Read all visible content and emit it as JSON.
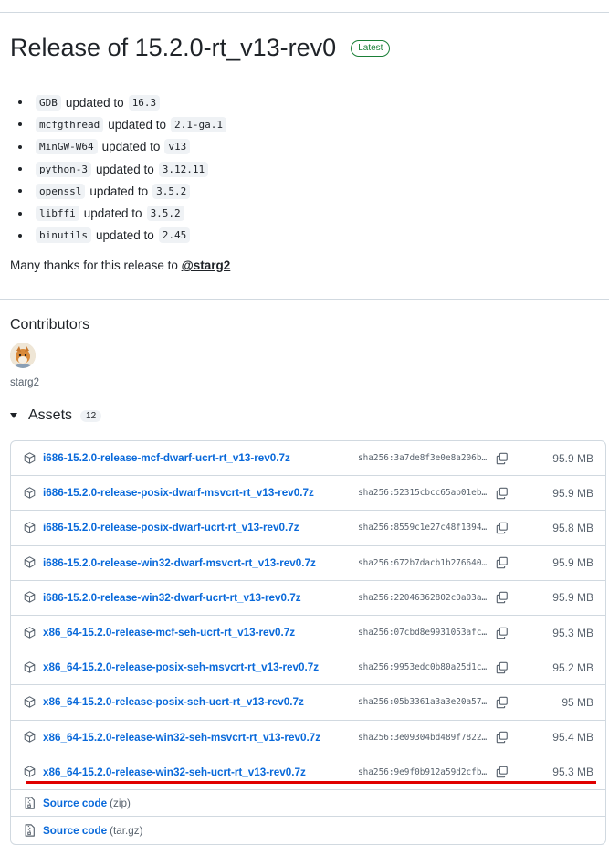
{
  "release": {
    "title": "Release of 15.2.0-rt_v13-rev0",
    "badge": "Latest"
  },
  "notes": [
    {
      "pkg": "GDB",
      "word": "updated to",
      "ver": "16.3"
    },
    {
      "pkg": "mcfgthread",
      "word": "updated to",
      "ver": "2.1-ga.1"
    },
    {
      "pkg": "MinGW-W64",
      "word": "updated to",
      "ver": "v13"
    },
    {
      "pkg": "python-3",
      "word": "updated to",
      "ver": "3.12.11"
    },
    {
      "pkg": "openssl",
      "word": "updated to",
      "ver": "3.5.2"
    },
    {
      "pkg": "libffi",
      "word": "updated to",
      "ver": "3.5.2"
    },
    {
      "pkg": "binutils",
      "word": "updated to",
      "ver": "2.45"
    }
  ],
  "thanks": {
    "text": "Many thanks for this release to",
    "user": "@starg2"
  },
  "contributors": {
    "heading": "Contributors",
    "name": "starg2"
  },
  "assets": {
    "heading": "Assets",
    "count": "12",
    "items": [
      {
        "name": "i686-15.2.0-release-mcf-dwarf-ucrt-rt_v13-rev0.7z",
        "sha": "sha256:3a7de8f3e0e8a206b…",
        "size": "95.9 MB"
      },
      {
        "name": "i686-15.2.0-release-posix-dwarf-msvcrt-rt_v13-rev0.7z",
        "sha": "sha256:52315cbcc65ab01eb…",
        "size": "95.9 MB"
      },
      {
        "name": "i686-15.2.0-release-posix-dwarf-ucrt-rt_v13-rev0.7z",
        "sha": "sha256:8559c1e27c48f1394…",
        "size": "95.8 MB"
      },
      {
        "name": "i686-15.2.0-release-win32-dwarf-msvcrt-rt_v13-rev0.7z",
        "sha": "sha256:672b7dacb1b276640…",
        "size": "95.9 MB"
      },
      {
        "name": "i686-15.2.0-release-win32-dwarf-ucrt-rt_v13-rev0.7z",
        "sha": "sha256:22046362802c0a03a…",
        "size": "95.9 MB"
      },
      {
        "name": "x86_64-15.2.0-release-mcf-seh-ucrt-rt_v13-rev0.7z",
        "sha": "sha256:07cbd8e9931053afc…",
        "size": "95.3 MB"
      },
      {
        "name": "x86_64-15.2.0-release-posix-seh-msvcrt-rt_v13-rev0.7z",
        "sha": "sha256:9953edc0b80a25d1c…",
        "size": "95.2 MB"
      },
      {
        "name": "x86_64-15.2.0-release-posix-seh-ucrt-rt_v13-rev0.7z",
        "sha": "sha256:05b3361a3a3e20a57…",
        "size": "95 MB"
      },
      {
        "name": "x86_64-15.2.0-release-win32-seh-msvcrt-rt_v13-rev0.7z",
        "sha": "sha256:3e09304bd489f7822…",
        "size": "95.4 MB"
      },
      {
        "name": "x86_64-15.2.0-release-win32-seh-ucrt-rt_v13-rev0.7z",
        "sha": "sha256:9e9f0b912a59d2cfb…",
        "size": "95.3 MB"
      }
    ],
    "source": [
      {
        "label": "Source code",
        "suffix": "(zip)"
      },
      {
        "label": "Source code",
        "suffix": "(tar.gz)"
      }
    ]
  },
  "colors": {
    "link": "#0969da",
    "badge": "#1a7f37",
    "highlight": "#e00000"
  },
  "icons": {
    "asset": "package-icon",
    "copy": "copy-icon",
    "source": "file-zip-icon",
    "toggle": "triangle-down-icon"
  }
}
